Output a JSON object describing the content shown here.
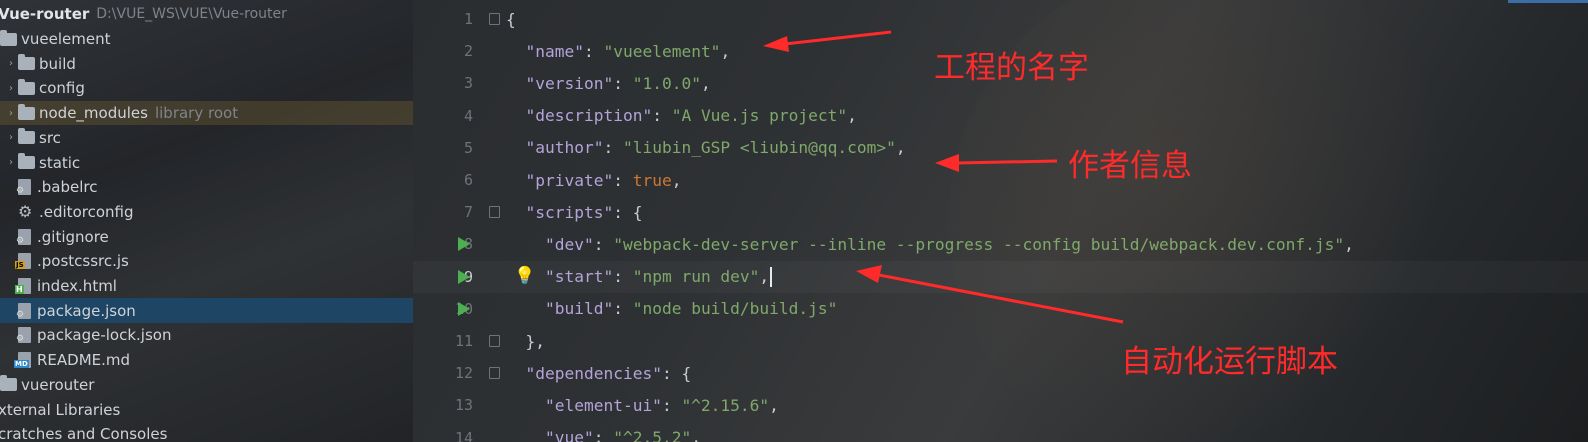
{
  "project": {
    "root_name": "Vue-router",
    "root_path": "D:\\VUE_WS\\VUE\\Vue-router",
    "items": [
      {
        "label": "vueelement",
        "kind": "module",
        "depth": 1
      },
      {
        "label": "build",
        "kind": "folder",
        "depth": 2
      },
      {
        "label": "config",
        "kind": "folder",
        "depth": 2
      },
      {
        "label": "node_modules",
        "kind": "folder",
        "depth": 2,
        "note": "library root"
      },
      {
        "label": "src",
        "kind": "folder",
        "depth": 2
      },
      {
        "label": "static",
        "kind": "folder",
        "depth": 2
      },
      {
        "label": ".babelrc",
        "kind": "config-file",
        "depth": 2
      },
      {
        "label": ".editorconfig",
        "kind": "gear-file",
        "depth": 2
      },
      {
        "label": ".gitignore",
        "kind": "config-file",
        "depth": 2
      },
      {
        "label": ".postcssrc.js",
        "kind": "js-file",
        "depth": 2
      },
      {
        "label": "index.html",
        "kind": "html-file",
        "depth": 2
      },
      {
        "label": "package.json",
        "kind": "config-file",
        "depth": 2,
        "selected": true
      },
      {
        "label": "package-lock.json",
        "kind": "config-file",
        "depth": 2
      },
      {
        "label": "README.md",
        "kind": "md-file",
        "depth": 2
      },
      {
        "label": "vuerouter",
        "kind": "module",
        "depth": 1
      },
      {
        "label": "xternal Libraries",
        "kind": "libs",
        "depth": 0
      },
      {
        "label": "cratches and Consoles",
        "kind": "scratches",
        "depth": 0
      }
    ]
  },
  "editor": {
    "current_line": 9,
    "lines": [
      {
        "n": "1",
        "tokens": [
          [
            "punc",
            "{"
          ]
        ]
      },
      {
        "n": "2",
        "tokens": [
          [
            "punc",
            "  "
          ],
          [
            "key",
            "\"name\""
          ],
          [
            "punc",
            ": "
          ],
          [
            "str",
            "\"vueelement\""
          ],
          [
            "punc",
            ","
          ]
        ]
      },
      {
        "n": "3",
        "tokens": [
          [
            "punc",
            "  "
          ],
          [
            "key",
            "\"version\""
          ],
          [
            "punc",
            ": "
          ],
          [
            "str",
            "\"1.0.0\""
          ],
          [
            "punc",
            ","
          ]
        ]
      },
      {
        "n": "4",
        "tokens": [
          [
            "punc",
            "  "
          ],
          [
            "key",
            "\"description\""
          ],
          [
            "punc",
            ": "
          ],
          [
            "str",
            "\"A Vue.js project\""
          ],
          [
            "punc",
            ","
          ]
        ]
      },
      {
        "n": "5",
        "tokens": [
          [
            "punc",
            "  "
          ],
          [
            "key",
            "\"author\""
          ],
          [
            "punc",
            ": "
          ],
          [
            "str",
            "\"liubin_GSP <liubin@qq.com>\""
          ],
          [
            "punc",
            ","
          ]
        ]
      },
      {
        "n": "6",
        "tokens": [
          [
            "punc",
            "  "
          ],
          [
            "key",
            "\"private\""
          ],
          [
            "punc",
            ": "
          ],
          [
            "kw",
            "true"
          ],
          [
            "punc",
            ","
          ]
        ]
      },
      {
        "n": "7",
        "tokens": [
          [
            "punc",
            "  "
          ],
          [
            "key",
            "\"scripts\""
          ],
          [
            "punc",
            ": {"
          ]
        ]
      },
      {
        "n": "8",
        "tokens": [
          [
            "punc",
            "    "
          ],
          [
            "key",
            "\"dev\""
          ],
          [
            "punc",
            ": "
          ],
          [
            "str",
            "\"webpack-dev-server --inline --progress --config build/webpack.dev.conf.js\""
          ],
          [
            "punc",
            ","
          ]
        ]
      },
      {
        "n": "9",
        "tokens": [
          [
            "punc",
            "    "
          ],
          [
            "key",
            "\"start\""
          ],
          [
            "punc",
            ": "
          ],
          [
            "str",
            "\"npm run dev\""
          ],
          [
            "punc",
            ","
          ]
        ]
      },
      {
        "n": "10",
        "tokens": [
          [
            "punc",
            "    "
          ],
          [
            "key",
            "\"build\""
          ],
          [
            "punc",
            ": "
          ],
          [
            "str",
            "\"node build/build.js\""
          ]
        ]
      },
      {
        "n": "11",
        "tokens": [
          [
            "punc",
            "  },"
          ]
        ]
      },
      {
        "n": "12",
        "tokens": [
          [
            "punc",
            "  "
          ],
          [
            "key",
            "\"dependencies\""
          ],
          [
            "punc",
            ": {"
          ]
        ]
      },
      {
        "n": "13",
        "tokens": [
          [
            "punc",
            "    "
          ],
          [
            "key",
            "\"element-ui\""
          ],
          [
            "punc",
            ": "
          ],
          [
            "str",
            "\"^2.15.6\""
          ],
          [
            "punc",
            ","
          ]
        ]
      },
      {
        "n": "14",
        "tokens": [
          [
            "punc",
            "    "
          ],
          [
            "key",
            "\"vue\""
          ],
          [
            "punc",
            ": "
          ],
          [
            "str",
            "\"^2.5.2\""
          ],
          [
            "punc",
            ","
          ]
        ]
      }
    ],
    "run_lines": [
      8,
      9,
      10
    ],
    "fold_lines": [
      1,
      7,
      11,
      12
    ]
  },
  "annotations": {
    "name_note": "工程的名字",
    "author_note": "作者信息",
    "scripts_note": "自动化运行脚本",
    "color": "#ff2a2a"
  }
}
